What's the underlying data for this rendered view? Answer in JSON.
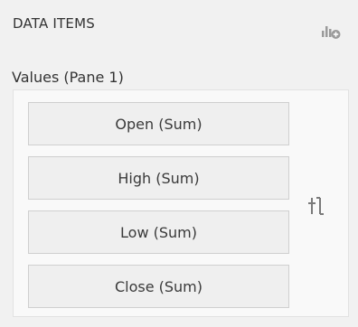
{
  "header": {
    "title": "DATA ITEMS",
    "add_icon": "add-data-item-icon"
  },
  "pane": {
    "label": "Values (Pane 1)",
    "items": [
      {
        "label": "Open (Sum)"
      },
      {
        "label": "High (Sum)"
      },
      {
        "label": "Low (Sum)"
      },
      {
        "label": "Close (Sum)"
      }
    ],
    "sort_icon": "reorder-icon"
  },
  "colors": {
    "panel_bg": "#f1f1f1",
    "item_bg": "#efefef",
    "item_border": "#cfcfcf",
    "text": "#333333",
    "icon": "#8a8a8a"
  }
}
